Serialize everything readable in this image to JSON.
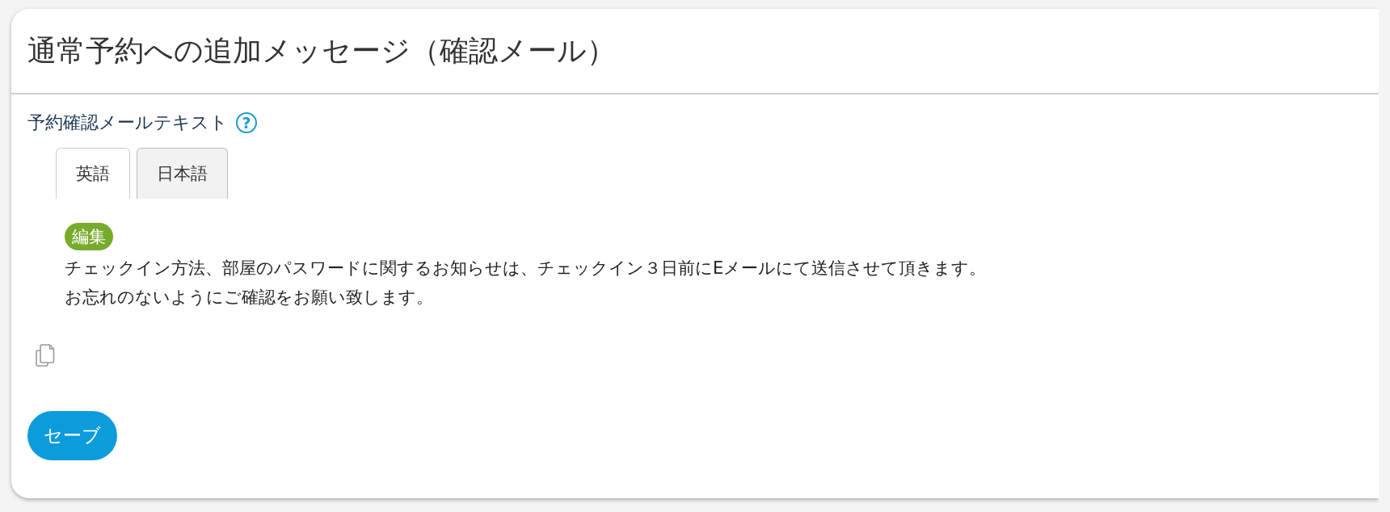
{
  "title": "通常予約への追加メッセージ（確認メール）",
  "field_label": "予約確認メールテキスト",
  "help_icon": "?",
  "tabs": [
    {
      "label": "英語",
      "selected": true
    },
    {
      "label": "日本語",
      "selected": false
    }
  ],
  "edit_badge": "編集",
  "message_lines": [
    "チェックイン方法、部屋のパスワードに関するお知らせは、チェックイン３日前にEメールにて送信させて頂きます。",
    "お忘れのないようにご確認をお願い致します。"
  ],
  "save_button": "セーブ"
}
